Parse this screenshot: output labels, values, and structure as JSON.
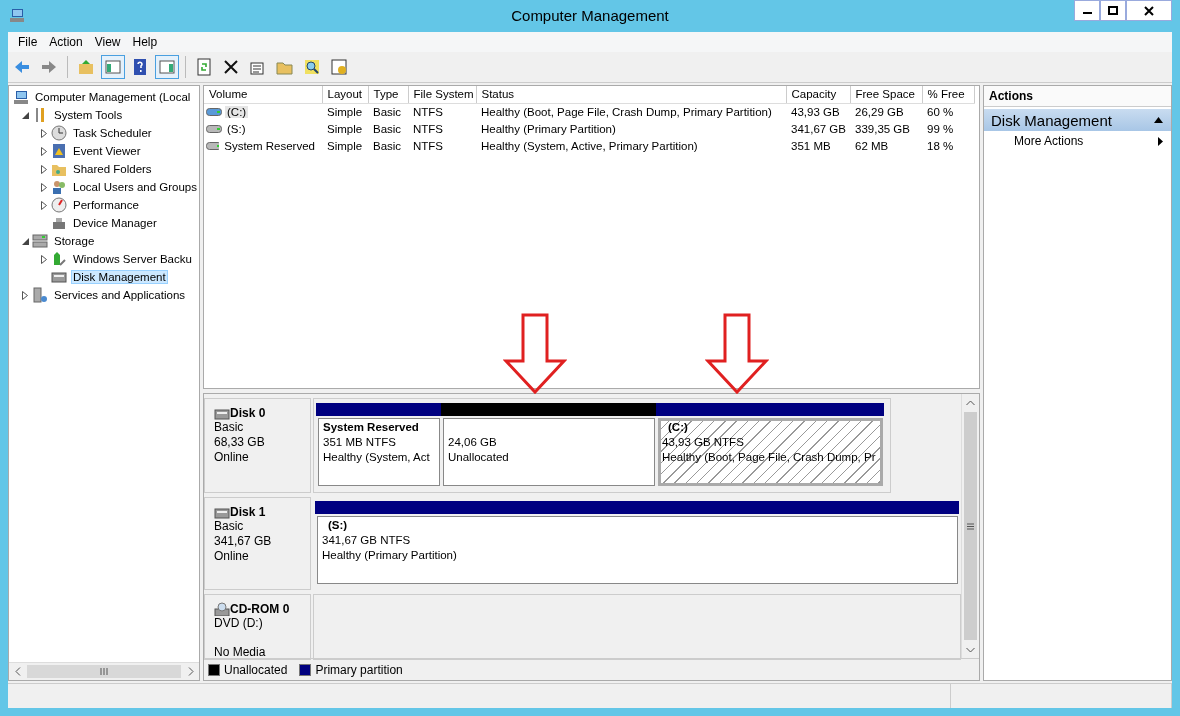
{
  "window": {
    "title": "Computer Management"
  },
  "menu": [
    "File",
    "Action",
    "View",
    "Help"
  ],
  "toolbar": [
    [
      {
        "kind": "back"
      },
      {
        "kind": "forward"
      }
    ],
    [
      {
        "kind": "up"
      },
      {
        "kind": "tree",
        "pressed": true
      },
      {
        "kind": "help"
      },
      {
        "kind": "pane",
        "pressed": true
      }
    ],
    [
      {
        "kind": "refresh"
      },
      {
        "kind": "delete"
      },
      {
        "kind": "props"
      },
      {
        "kind": "open"
      },
      {
        "kind": "find"
      },
      {
        "kind": "settings"
      }
    ]
  ],
  "tree": [
    {
      "label": "Computer Management (Local",
      "kind": "computer",
      "selected": false,
      "children": [
        {
          "label": "System Tools",
          "kind": "tools",
          "expanded": true,
          "selected": false,
          "children": [
            {
              "label": "Task Scheduler",
              "kind": "clock",
              "expanded": false,
              "selected": false
            },
            {
              "label": "Event Viewer",
              "kind": "log",
              "expanded": false,
              "selected": false
            },
            {
              "label": "Shared Folders",
              "kind": "folder",
              "expanded": false,
              "selected": false
            },
            {
              "label": "Local Users and Groups",
              "kind": "users",
              "expanded": false,
              "selected": false
            },
            {
              "label": "Performance",
              "kind": "gauge",
              "expanded": false,
              "selected": false
            },
            {
              "label": "Device Manager",
              "kind": "device",
              "selected": false
            }
          ]
        },
        {
          "label": "Storage",
          "kind": "storage",
          "expanded": true,
          "selected": false,
          "children": [
            {
              "label": "Windows Server Backu",
              "kind": "backup",
              "expanded": false,
              "selected": false
            },
            {
              "label": "Disk Management",
              "kind": "disk",
              "selected": true
            }
          ]
        },
        {
          "label": "Services and Applications",
          "kind": "services",
          "expanded": false,
          "selected": false
        }
      ]
    }
  ],
  "volumes": {
    "columns": [
      "Volume",
      "Layout",
      "Type",
      "File System",
      "Status",
      "Capacity",
      "Free Space",
      "% Free"
    ],
    "rows": [
      {
        "selected": true,
        "kind": "system",
        "cells": [
          "(C:)",
          "Simple",
          "Basic",
          "NTFS",
          "Healthy (Boot, Page File, Crash Dump, Primary Partition)",
          "43,93 GB",
          "26,29 GB",
          "60 %"
        ]
      },
      {
        "selected": false,
        "kind": "data",
        "cells": [
          "(S:)",
          "Simple",
          "Basic",
          "NTFS",
          "Healthy (Primary Partition)",
          "341,67 GB",
          "339,35 GB",
          "99 %"
        ]
      },
      {
        "selected": false,
        "kind": "data",
        "cells": [
          "System Reserved",
          "Simple",
          "Basic",
          "NTFS",
          "Healthy (System, Active, Primary Partition)",
          "351 MB",
          "62 MB",
          "18 %"
        ]
      }
    ]
  },
  "disks": [
    {
      "name": "Disk 0",
      "kind": "disk",
      "lines": [
        "Basic",
        "68,33 GB",
        "Online"
      ],
      "partitions": [
        {
          "kind": "primary",
          "selected": false,
          "title": "System Reserved",
          "size": "351 MB NTFS",
          "status": "Healthy (System, Act"
        },
        {
          "kind": "unallocated",
          "selected": false,
          "size": "24,06 GB",
          "status": "Unallocated"
        },
        {
          "kind": "primary",
          "selected": true,
          "title": "(C:)",
          "size": "43,93 GB NTFS",
          "status": "Healthy (Boot, Page File, Crash Dump, Pr"
        }
      ]
    },
    {
      "name": "Disk 1",
      "kind": "disk",
      "lines": [
        "Basic",
        "341,67 GB",
        "Online"
      ],
      "partitions": [
        {
          "kind": "primary",
          "selected": false,
          "title": "(S:)",
          "size": "341,67 GB NTFS",
          "status": "Healthy (Primary Partition)"
        }
      ]
    },
    {
      "name": "CD-ROM 0",
      "kind": "cdrom",
      "lines": [
        "DVD (D:)",
        "No Media"
      ]
    }
  ],
  "legend": [
    {
      "label": "Unallocated",
      "color": "#000000"
    },
    {
      "label": "Primary partition",
      "color": "#000080"
    }
  ],
  "actions": {
    "title": "Actions",
    "sections": [
      {
        "title": "Disk Management",
        "expanded": true,
        "items": [
          "More Actions"
        ]
      }
    ]
  }
}
